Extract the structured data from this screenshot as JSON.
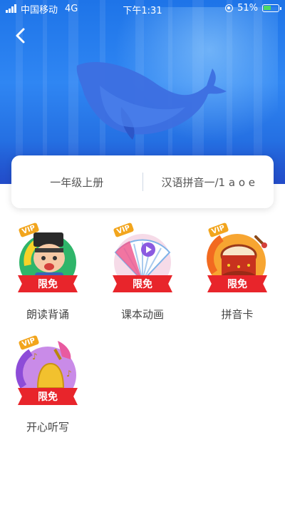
{
  "status_bar": {
    "carrier": "中国移动",
    "network": "4G",
    "time": "下午1:31",
    "battery": "51%"
  },
  "header": {
    "back_icon": "chevron-left-icon"
  },
  "info_card": {
    "grade": "一年级上册",
    "lesson": "汉语拼音一/1 a o e"
  },
  "features": [
    {
      "label": "朗读背诵",
      "badge": "限免",
      "vip": "VIP",
      "icon": "reading-icon"
    },
    {
      "label": "课本动画",
      "badge": "限免",
      "vip": "VIP",
      "icon": "animation-icon"
    },
    {
      "label": "拼音卡",
      "badge": "限免",
      "vip": "VIP",
      "icon": "drum-icon"
    },
    {
      "label": "开心听写",
      "badge": "限免",
      "vip": "VIP",
      "icon": "bell-icon"
    }
  ],
  "colors": {
    "banner": "#2f86f3",
    "badge": "#e8252b",
    "vip": "#f2a51d"
  }
}
